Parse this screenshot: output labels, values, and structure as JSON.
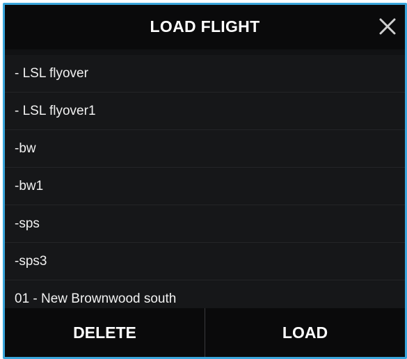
{
  "dialog": {
    "title": "LOAD FLIGHT",
    "close_icon": "close-icon"
  },
  "list": {
    "items": [
      {
        "label": "- LSL flyover"
      },
      {
        "label": "- LSL flyover1"
      },
      {
        "label": "-bw"
      },
      {
        "label": "-bw1"
      },
      {
        "label": "-sps"
      },
      {
        "label": "-sps3"
      },
      {
        "label": "01 - New Brownwood south"
      }
    ]
  },
  "footer": {
    "delete_label": "DELETE",
    "load_label": "LOAD"
  },
  "colors": {
    "accent_border": "#3aa6dc",
    "background": "#111214",
    "text": "#ffffff"
  }
}
